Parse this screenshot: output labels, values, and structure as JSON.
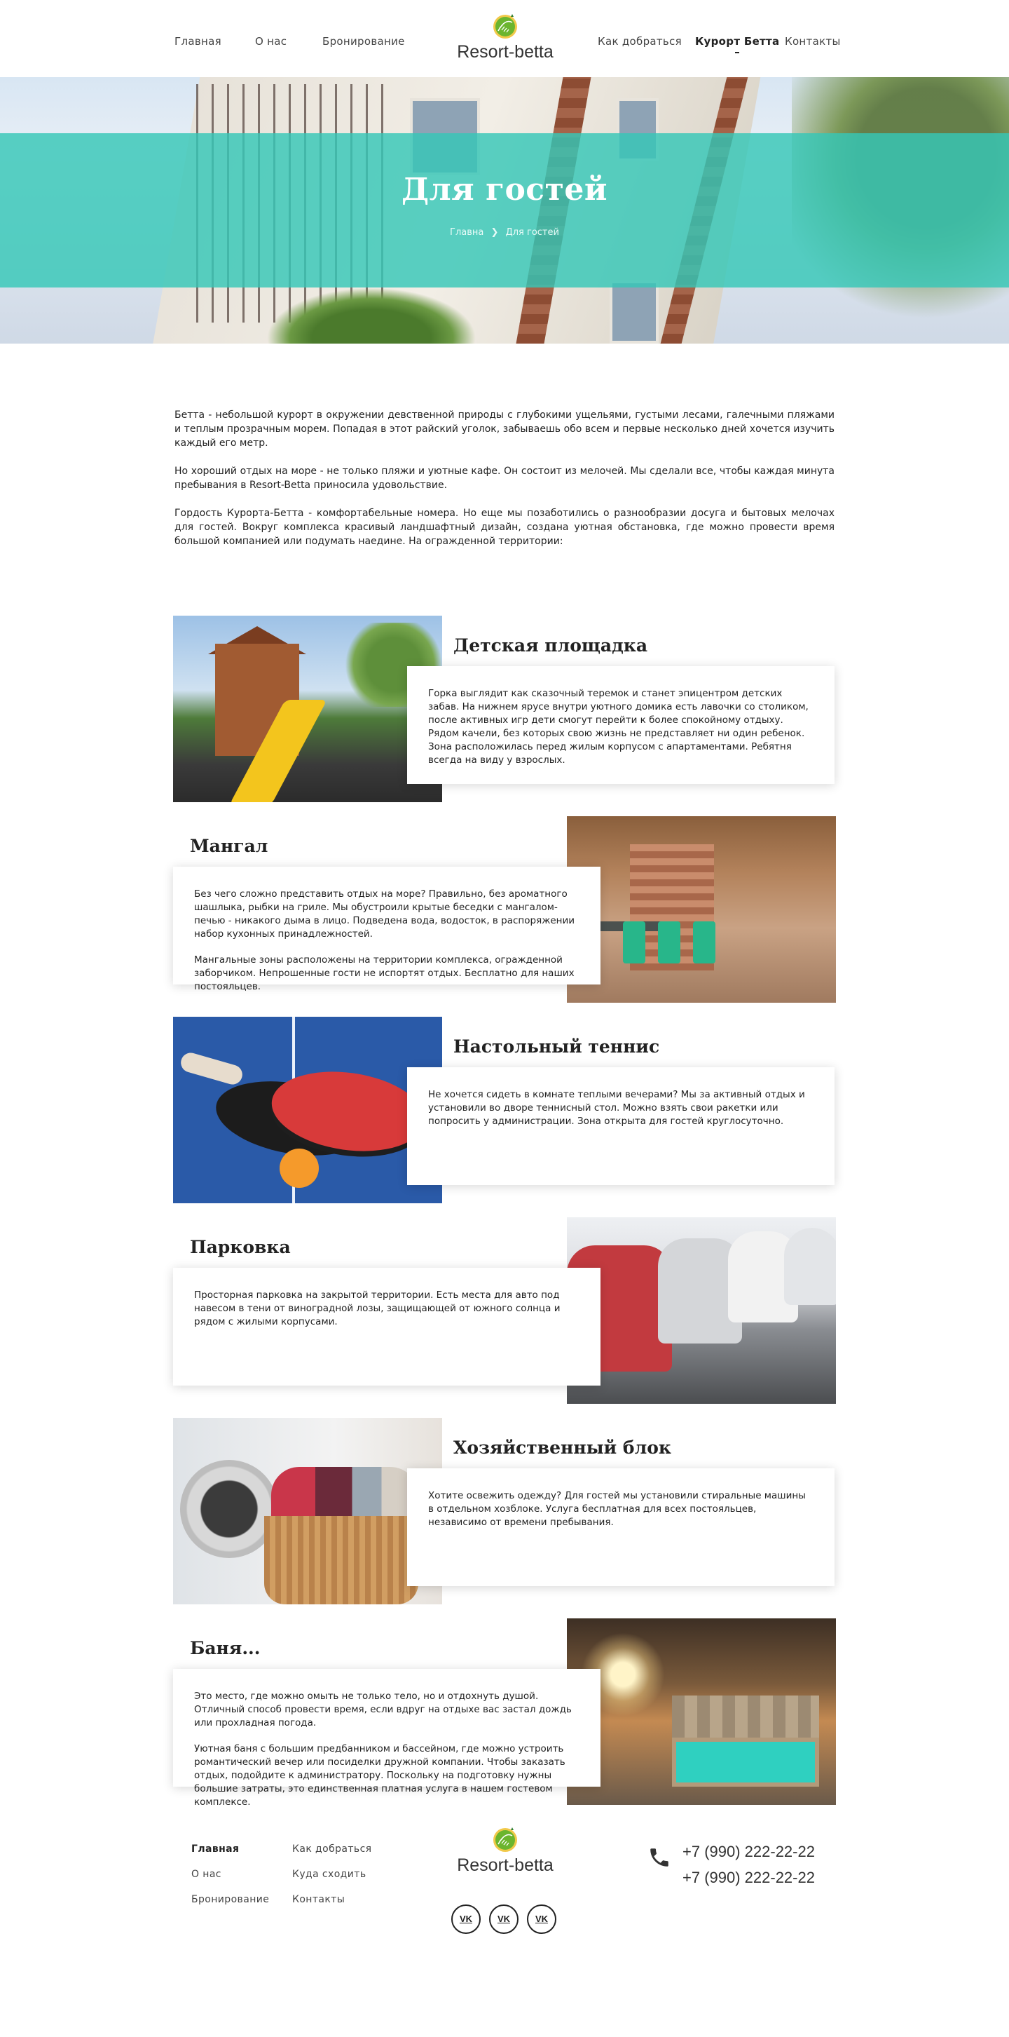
{
  "header": {
    "nav": [
      {
        "label": "Главная"
      },
      {
        "label": "О нас"
      },
      {
        "label": "Бронирование"
      },
      {
        "label": "Как добраться"
      },
      {
        "label": "Курорт Бетта"
      },
      {
        "label": "Контакты"
      }
    ],
    "logo_text": "Resort-betta"
  },
  "hero": {
    "title": "Для гостей",
    "breadcrumb": {
      "home": "Главна",
      "current": "Для гостей"
    }
  },
  "intro": [
    "Бетта - небольшой курорт в окружении девственной природы с глубокими ущельями, густыми лесами, галечными пляжами и теплым прозрачным морем. Попадая в этот райский уголок, забываешь обо всем и первые несколько дней хочется изучить каждый его метр.",
    "Но хороший отдых на море - не только пляжи и уютные кафе. Он состоит из мелочей. Мы сделали все, чтобы каждая минута пребывания в Resort-Betta приносила удовольствие.",
    "Гордость Курорта-Бетта - комфортабельные номера. Но еще мы позаботились о разнообразии досуга и бытовых мелочах для гостей. Вокруг комплекса красивый ландшафтный дизайн, создана уютная обстановка, где можно провести время большой компанией или подумать наедине. На огражденной территории:"
  ],
  "amenities": [
    {
      "title": "Детская площадка",
      "paragraphs": [
        "Горка выглядит как сказочный теремок и станет эпицентром детских забав. На нижнем ярусе внутри уютного домика есть лавочки со столиком, после активных игр дети смогут перейти к более спокойному отдыху. Рядом качели, без которых свою жизнь не представляет ни один ребенок. Зона расположилась перед жилым корпусом с апартаментами. Ребятня всегда на виду у взрослых."
      ]
    },
    {
      "title": "Мангал",
      "paragraphs": [
        "Без чего сложно представить отдых на море? Правильно, без ароматного шашлыка, рыбки на гриле. Мы обустроили крытые беседки с мангалом-печью - никакого дыма в лицо. Подведена вода, водосток, в распоряжении набор кухонных принадлежностей.",
        "Мангальные зоны расположены на территории комплекса, огражденной заборчиком. Непрошенные гости не испортят отдых. Бесплатно для наших постояльцев."
      ]
    },
    {
      "title": "Настольный теннис",
      "paragraphs": [
        "Не хочется сидеть в комнате теплыми вечерами? Мы за активный отдых и установили во дворе теннисный стол. Можно взять свои ракетки или попросить у администрации. Зона открыта для гостей круглосуточно."
      ]
    },
    {
      "title": "Парковка",
      "paragraphs": [
        "Просторная парковка на закрытой территории. Есть места для авто под навесом в тени от виноградной лозы, защищающей от южного солнца и рядом с жилыми корпусами."
      ]
    },
    {
      "title": "Хозяйственный блок",
      "paragraphs": [
        "Хотите освежить одежду? Для гостей мы установили стиральные машины в отдельном хозблоке. Услуга бесплатная для всех постояльцев, независимо от времени пребывания."
      ]
    },
    {
      "title": "Баня...",
      "paragraphs": [
        "Это место, где можно омыть не только тело, но и отдохнуть душой. Отличный способ провести время, если вдруг на отдыхе вас застал дождь или прохладная погода.",
        "Уютная баня с большим предбанником и бассейном, где можно устроить романтический вечер или посиделки дружной компании. Чтобы заказать отдых, подойдите к администратору. Поскольку на подготовку нужны большие затраты, это единственная платная услуга в нашем гостевом комплексе."
      ]
    }
  ],
  "footer": {
    "col1": [
      "Главная",
      "О нас",
      "Бронирование"
    ],
    "col2": [
      "Как добраться",
      "Куда сходить",
      "Контакты"
    ],
    "logo_text": "Resort-betta",
    "social": [
      "VK",
      "VK",
      "VK"
    ],
    "phones": [
      "+7 (990) 222-22-22",
      "+7 (990) 222-22-22"
    ]
  },
  "colors": {
    "accent": "#36c7b7",
    "text": "#222222",
    "logo_green": "#6bb52e"
  }
}
